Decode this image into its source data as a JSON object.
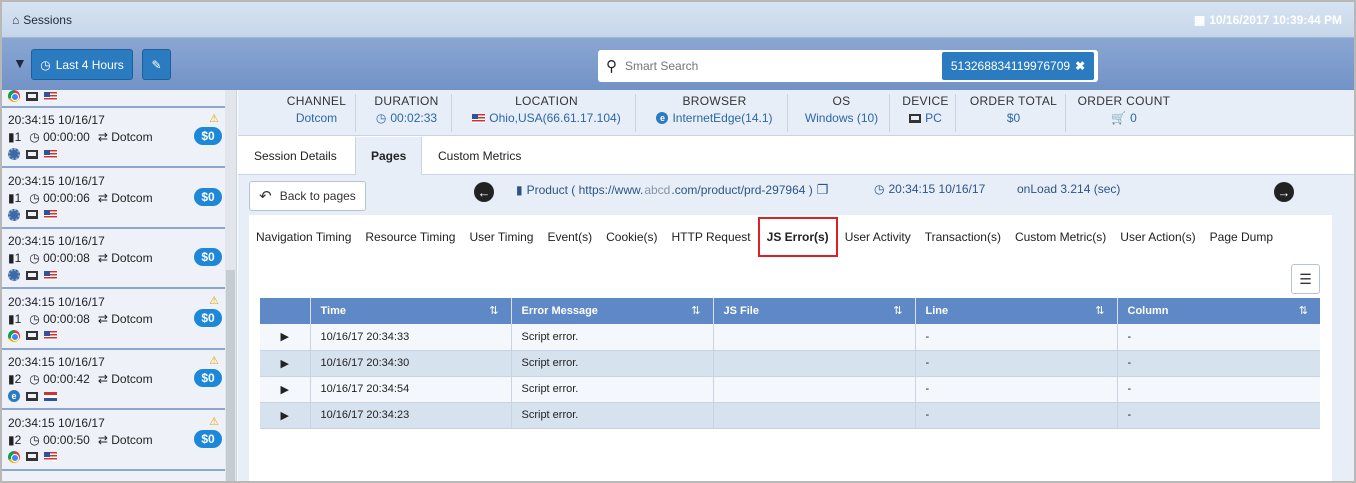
{
  "topbar": {
    "title": "Sessions",
    "datetime": "10/16/2017 10:39:44 PM"
  },
  "toolbar": {
    "time_range": "Last 4 Hours",
    "search_placeholder": "Smart Search",
    "search_tag": "513268834119976709"
  },
  "sessions": [
    {
      "time": "20:34:15 10/16/17",
      "pages": "1",
      "duration": "00:00:00",
      "channel": "Dotcom",
      "amount": "$0",
      "warn": true,
      "browser": "gear",
      "flag": "us"
    },
    {
      "time": "20:34:15 10/16/17",
      "pages": "1",
      "duration": "00:00:06",
      "channel": "Dotcom",
      "amount": "$0",
      "warn": false,
      "browser": "gear",
      "flag": "us"
    },
    {
      "time": "20:34:15 10/16/17",
      "pages": "1",
      "duration": "00:00:08",
      "channel": "Dotcom",
      "amount": "$0",
      "warn": false,
      "browser": "gear",
      "flag": "us"
    },
    {
      "time": "20:34:15 10/16/17",
      "pages": "1",
      "duration": "00:00:08",
      "channel": "Dotcom",
      "amount": "$0",
      "warn": true,
      "browser": "chrome",
      "flag": "us"
    },
    {
      "time": "20:34:15 10/16/17",
      "pages": "2",
      "duration": "00:00:42",
      "channel": "Dotcom",
      "amount": "$0",
      "warn": true,
      "browser": "edge",
      "flag": "nl"
    },
    {
      "time": "20:34:15 10/16/17",
      "pages": "2",
      "duration": "00:00:50",
      "channel": "Dotcom",
      "amount": "$0",
      "warn": true,
      "browser": "chrome",
      "flag": "us"
    }
  ],
  "summary": {
    "channel": {
      "label": "CHANNEL",
      "value": "Dotcom"
    },
    "duration": {
      "label": "DURATION",
      "value": "00:02:33"
    },
    "location": {
      "label": "LOCATION",
      "value": "Ohio,USA(66.61.17.104)"
    },
    "browser": {
      "label": "BROWSER",
      "value": "InternetEdge(14.1)"
    },
    "os": {
      "label": "OS",
      "value": "Windows (10)"
    },
    "device": {
      "label": "DEVICE",
      "value": "PC"
    },
    "order_total": {
      "label": "ORDER TOTAL",
      "value": "$0"
    },
    "order_count": {
      "label": "ORDER COUNT",
      "value": "0"
    }
  },
  "tabs": [
    "Session Details",
    "Pages",
    "Custom Metrics"
  ],
  "page_bar": {
    "back": "Back to pages",
    "product": "Product ( https://www.",
    "domain": "abcd",
    "product_rest": ".com/product/prd-297964 )",
    "time": "20:34:15 10/16/17",
    "onload": "onLoad 3.214 (sec)"
  },
  "subtabs": [
    "Navigation Timing",
    "Resource Timing",
    "User Timing",
    "Event(s)",
    "Cookie(s)",
    "HTTP Request",
    "JS Error(s)",
    "User Activity",
    "Transaction(s)",
    "Custom Metric(s)",
    "User Action(s)",
    "Page Dump"
  ],
  "table": {
    "headers": [
      "Time",
      "Error Message",
      "JS File",
      "Line",
      "Column"
    ],
    "rows": [
      [
        "10/16/17 20:34:33",
        "Script error.",
        "",
        "-",
        "-"
      ],
      [
        "10/16/17 20:34:30",
        "Script error.",
        "",
        "-",
        "-"
      ],
      [
        "10/16/17 20:34:54",
        "Script error.",
        "",
        "-",
        "-"
      ],
      [
        "10/16/17 20:34:23",
        "Script error.",
        "",
        "-",
        "-"
      ]
    ]
  }
}
